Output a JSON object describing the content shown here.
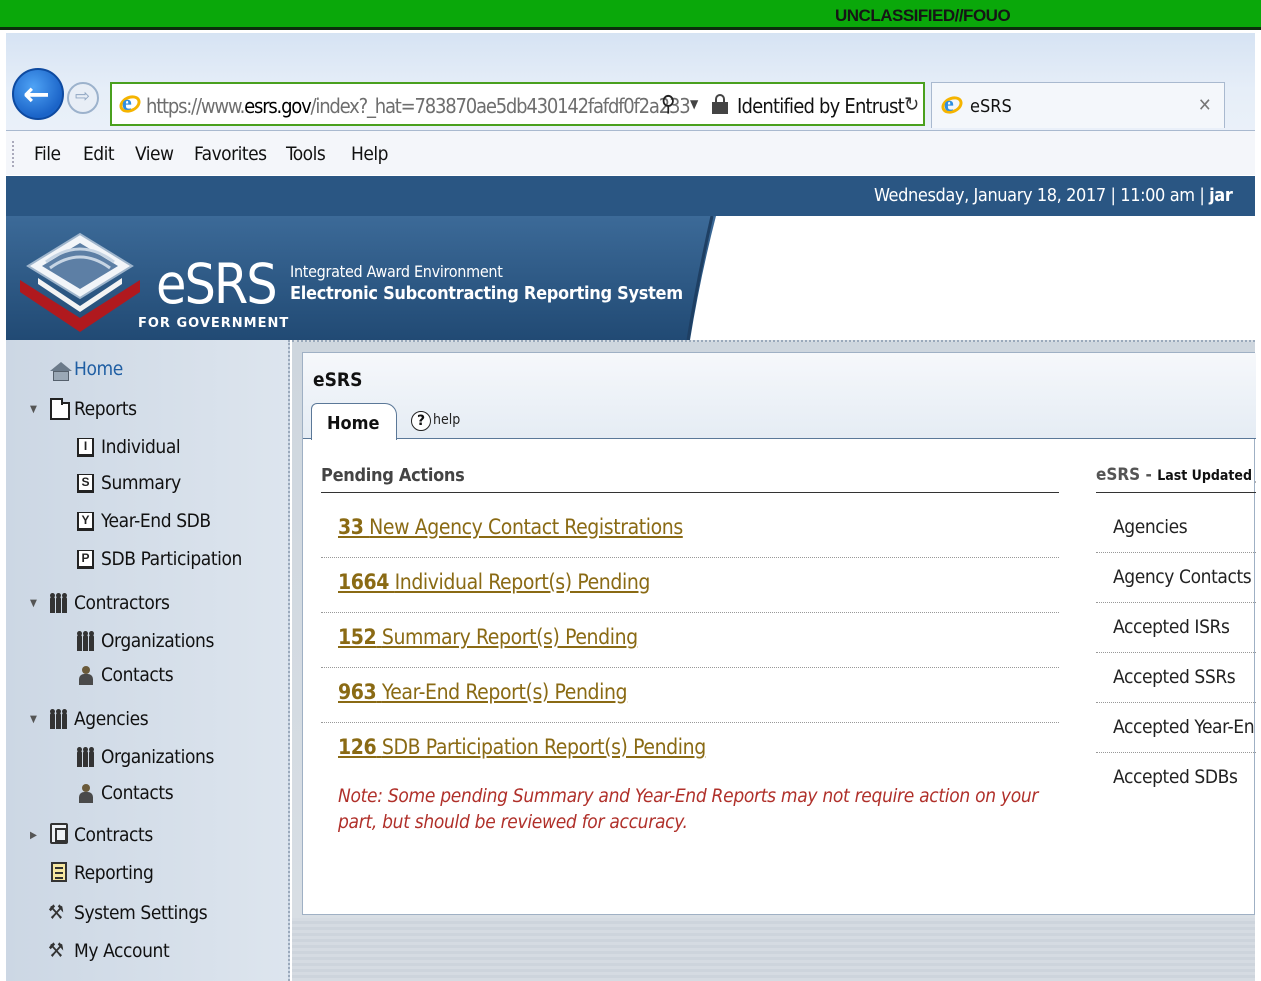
{
  "classification": "UNCLASSIFIED//FOUO",
  "browser": {
    "url_prefix": "https://www.",
    "url_domain": "esrs.gov",
    "url_path": "/index?_hat=783870ae5db430142fafdf0f2a233",
    "identity": "Identified by Entrust",
    "tab_title": "eSRS",
    "menu": [
      "File",
      "Edit",
      "View",
      "Favorites",
      "Tools",
      "Help"
    ]
  },
  "header": {
    "datetime": "Wednesday, January 18, 2017 | 11:00 am | ",
    "user": "jar",
    "logo_word": "eSRS",
    "logo_sub": "FOR GOVERNMENT",
    "line1": "Integrated Award Environment",
    "line2": "Electronic Subcontracting Reporting System"
  },
  "sidebar": {
    "home": "Home",
    "reports": "Reports",
    "individual": "Individual",
    "summary": "Summary",
    "yearend": "Year-End SDB",
    "sdbpart": "SDB Participation",
    "contractors": "Contractors",
    "c_orgs": "Organizations",
    "c_contacts": "Contacts",
    "agencies": "Agencies",
    "a_orgs": "Organizations",
    "a_contacts": "Contacts",
    "contracts": "Contracts",
    "reporting": "Reporting",
    "system_settings": "System Settings",
    "my_account": "My Account"
  },
  "main": {
    "title": "eSRS",
    "tab_home": "Home",
    "help": "help",
    "pending_title": "Pending Actions",
    "actions": [
      {
        "count": "33",
        "text": "New Agency Contact Registrations"
      },
      {
        "count": "1664",
        "text": "Individual Report(s) Pending"
      },
      {
        "count": "152",
        "text": "Summary Report(s) Pending"
      },
      {
        "count": "963",
        "text": "Year-End Report(s) Pending"
      },
      {
        "count": "126",
        "text": "SDB Participation Report(s) Pending"
      }
    ],
    "note": "Note: Some pending Summary and Year-End Reports may not require action on your part, but should be reviewed for accuracy.",
    "right_title_a": "eSRS",
    "right_title_b": "Last Updated J",
    "stats": [
      "Agencies",
      "Agency Contacts",
      "Accepted ISRs",
      "Accepted SSRs",
      "Accepted Year-En",
      "Accepted SDBs"
    ]
  }
}
